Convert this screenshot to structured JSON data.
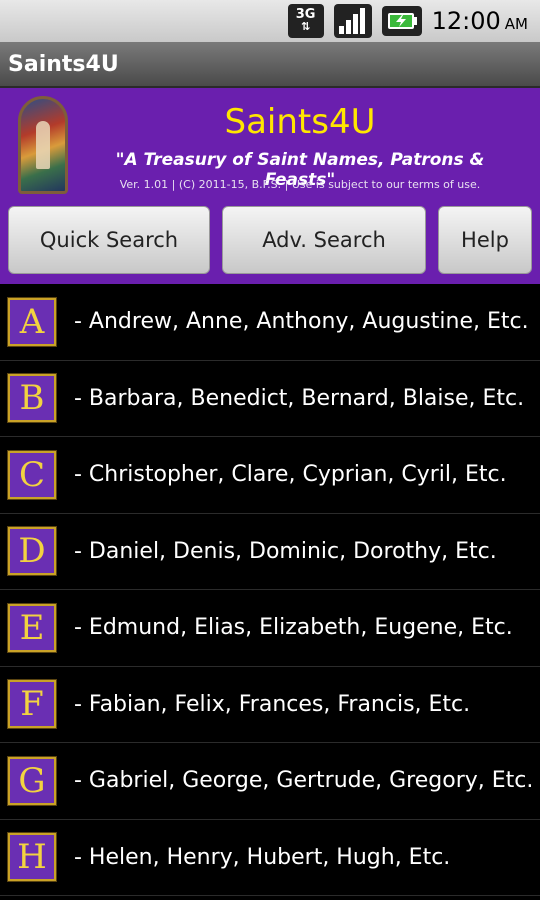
{
  "status_bar": {
    "network": "3G",
    "time": "12:00",
    "ampm": "AM",
    "icons": [
      "3g-network-icon",
      "signal-strength-icon",
      "battery-charging-icon"
    ]
  },
  "title_bar": {
    "title": "Saints4U"
  },
  "header": {
    "app_title": "Saints4U",
    "subtitle": "\"A Treasury of Saint Names, Patrons & Feasts\"",
    "version": "Ver. 1.01 | (C) 2011-15, B.F.S. | Use is subject to our terms of use.",
    "accent_color": "#6a1fae",
    "title_color": "#ffe600"
  },
  "buttons": {
    "quick_search": "Quick Search",
    "adv_search": "Adv. Search",
    "help": "Help"
  },
  "letters": [
    {
      "letter": "A",
      "text": "-  Andrew, Anne, Anthony, Augustine, Etc."
    },
    {
      "letter": "B",
      "text": "-  Barbara, Benedict, Bernard, Blaise, Etc."
    },
    {
      "letter": "C",
      "text": "-  Christopher, Clare, Cyprian, Cyril, Etc."
    },
    {
      "letter": "D",
      "text": "-  Daniel, Denis, Dominic, Dorothy, Etc."
    },
    {
      "letter": "E",
      "text": "-  Edmund, Elias, Elizabeth, Eugene, Etc."
    },
    {
      "letter": "F",
      "text": "-  Fabian, Felix, Frances, Francis, Etc."
    },
    {
      "letter": "G",
      "text": "-  Gabriel, George, Gertrude, Gregory, Etc."
    },
    {
      "letter": "H",
      "text": "-  Helen, Henry, Hubert, Hugh, Etc."
    }
  ]
}
